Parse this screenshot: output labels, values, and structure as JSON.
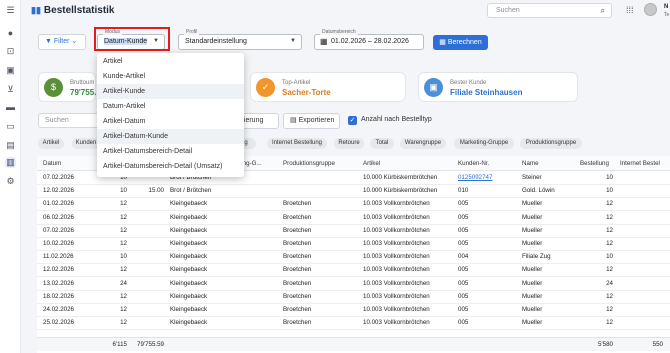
{
  "app": {
    "title": "Bestellstatistik"
  },
  "header": {
    "search_placeholder": "Suchen",
    "user_initial": "N",
    "user_sub": "Te"
  },
  "rail": [
    "menu-icon",
    "user-icon",
    "scan-icon",
    "briefcase-icon",
    "cart-icon",
    "truck-icon",
    "card-icon",
    "document-icon",
    "chart-icon",
    "gear-icon"
  ],
  "filters": {
    "filter_label": "Filter",
    "modus_label": "Modus",
    "modus_value": "Datum-Kunde",
    "profil_label": "Profil",
    "profil_value": "Standardeinstellung",
    "datum_label": "Datumsbereich",
    "datum_value": "01.02.2026 – 28.02.2026",
    "berechnen_label": "Berechnen"
  },
  "dropdown": {
    "options": [
      "Artikel",
      "Kunde-Artikel",
      "Artikel-Kunde",
      "Datum-Artikel",
      "Artikel-Datum",
      "Artikel-Datum-Kunde",
      "Artikel-Datumsbereich-Detail",
      "Artikel-Datumsbereich-Detail (Umsatz)"
    ]
  },
  "cards": [
    {
      "title": "Bruttoum",
      "value": "79'755.",
      "color": "#5c8f3a",
      "icon": "money-icon"
    },
    {
      "title": "Top-Artikel",
      "value": "Sacher-Torte",
      "color": "#f0962b",
      "icon": "check-badge-icon"
    },
    {
      "title": "Bester Kunde",
      "value": "Filiale Steinhausen",
      "color": "#4a8fd8",
      "icon": "contact-icon"
    }
  ],
  "controls": {
    "search_placeholder": "Suchen",
    "gruppierung_label": "pierung",
    "export_label": "Exportieren",
    "anzahl_label": "Anzahl nach Bestelltyp"
  },
  "chips": [
    "Artikel",
    "Kunden",
    "lung",
    "Internet Bestellung",
    "Retoure",
    "Total",
    "Warengruppe",
    "Marketing-Gruppe",
    "Produktionsgruppe"
  ],
  "table": {
    "headers": [
      "Datum",
      "",
      "",
      "keting-G...",
      "Produktionsgruppe",
      "Artikel",
      "Kunden-Nr.",
      "Name",
      "Bestellung",
      "Internet Bestel"
    ],
    "rows": [
      [
        "07.02.2026",
        "10",
        "",
        "Brot / Brötchen",
        "",
        "10.000 Kürbiskernbrötchen",
        "0125092747",
        "Steiner",
        "10"
      ],
      [
        "12.02.2026",
        "10",
        "15.00",
        "Brot / Brötchen",
        "",
        "10.000 Kürbiskernbrötchen",
        "010",
        "Gold. Löwin",
        "10"
      ],
      [
        "01.02.2026",
        "12",
        "",
        "Kleingebaeck",
        "Broetchen",
        "10.003 Vollkornbrötchen",
        "005",
        "Mueller",
        "12"
      ],
      [
        "06.02.2026",
        "12",
        "",
        "Kleingebaeck",
        "Broetchen",
        "10.003 Vollkornbrötchen",
        "005",
        "Mueller",
        "12"
      ],
      [
        "07.02.2026",
        "12",
        "",
        "Kleingebaeck",
        "Broetchen",
        "10.003 Vollkornbrötchen",
        "005",
        "Mueller",
        "12"
      ],
      [
        "10.02.2026",
        "12",
        "",
        "Kleingebaeck",
        "Broetchen",
        "10.003 Vollkornbrötchen",
        "005",
        "Mueller",
        "12"
      ],
      [
        "11.02.2026",
        "10",
        "",
        "Kleingebaeck",
        "Broetchen",
        "10.003 Vollkornbrötchen",
        "004",
        "Filiale Zug",
        "10"
      ],
      [
        "12.02.2026",
        "12",
        "",
        "Kleingebaeck",
        "Broetchen",
        "10.003 Vollkornbrötchen",
        "005",
        "Mueller",
        "12"
      ],
      [
        "13.02.2026",
        "24",
        "",
        "Kleingebaeck",
        "Broetchen",
        "10.003 Vollkornbrötchen",
        "005",
        "Mueller",
        "24"
      ],
      [
        "18.02.2026",
        "12",
        "",
        "Kleingebaeck",
        "Broetchen",
        "10.003 Vollkornbrötchen",
        "005",
        "Mueller",
        "12"
      ],
      [
        "24.02.2026",
        "12",
        "",
        "Kleingebaeck",
        "Broetchen",
        "10.003 Vollkornbrötchen",
        "005",
        "Mueller",
        "12"
      ],
      [
        "25.02.2026",
        "12",
        "",
        "Kleingebaeck",
        "Broetchen",
        "10.003 Vollkornbrötchen",
        "005",
        "Mueller",
        "12"
      ]
    ],
    "footer": {
      "count": "6'115",
      "sum": "79'755.59",
      "bestellung": "5'580",
      "internet": "550"
    }
  }
}
